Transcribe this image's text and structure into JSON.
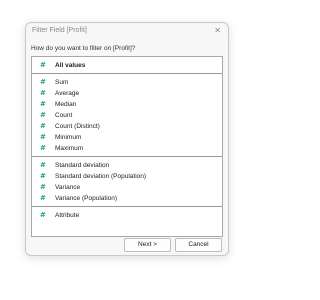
{
  "dialog": {
    "title": "Filter Field [Profit]",
    "close_glyph": "✕",
    "prompt": "How do you want to filter on [Profit]?",
    "options": [
      {
        "label": "All values",
        "icon": "hash-icon"
      },
      {
        "label": "Sum",
        "icon": "hash-icon"
      },
      {
        "label": "Average",
        "icon": "hash-icon"
      },
      {
        "label": "Median",
        "icon": "hash-icon"
      },
      {
        "label": "Count",
        "icon": "hash-icon"
      },
      {
        "label": "Count (Distinct)",
        "icon": "hash-icon"
      },
      {
        "label": "Minimum",
        "icon": "hash-icon"
      },
      {
        "label": "Maximum",
        "icon": "hash-icon"
      },
      {
        "label": "Standard deviation",
        "icon": "hash-icon"
      },
      {
        "label": "Standard deviation (Population)",
        "icon": "hash-icon"
      },
      {
        "label": "Variance",
        "icon": "hash-icon"
      },
      {
        "label": "Variance (Population)",
        "icon": "hash-icon"
      },
      {
        "label": "Attribute",
        "icon": "hash-icon"
      }
    ],
    "icon_glyph": "#",
    "buttons": {
      "next": "Next >",
      "cancel": "Cancel"
    },
    "accent_color": "#21a36b"
  }
}
